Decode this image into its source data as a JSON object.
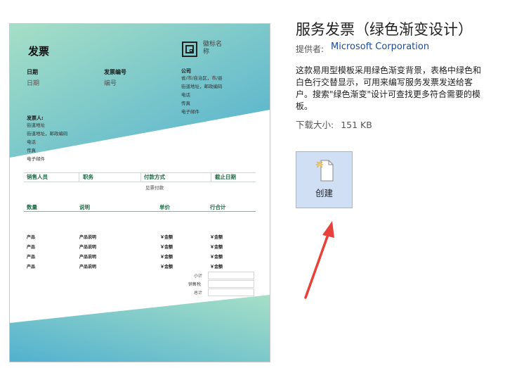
{
  "template": {
    "title": "服务发票（绿色渐变设计）",
    "provider_label": "提供者:",
    "provider": "Microsoft Corporation",
    "description": "这款易用型模板采用绿色渐变背景，表格中绿色和白色行交替显示，可用来编写服务发票发送给客户。搜索\"绿色渐变\"设计可查找更多符合需要的模板。",
    "size_label": "下载大小:",
    "size": "151 KB",
    "create_label": "创建"
  },
  "preview": {
    "heading": "发票",
    "logo_text": "徽标名称",
    "date_label": "日期",
    "date_value": "日期",
    "invoice_no_label": "发票编号",
    "invoice_no_value": "编号",
    "company_label": "公司",
    "company_lines": [
      "省/市/自治区，市/县",
      "街道地址，邮政编码",
      "电话",
      "传真",
      "电子邮件"
    ],
    "bill_to_label": "发票人:",
    "bill_to_lines": [
      "街道地址",
      "街道地址，邮政编码",
      "电话",
      "传真",
      "电子邮件"
    ],
    "sales_headers": [
      "销售人员",
      "职务",
      "付款方式",
      "截止日期"
    ],
    "payment_terms": "见票付款",
    "item_headers": [
      "数量",
      "说明",
      "单价",
      "行合计"
    ],
    "items": [
      {
        "product": "产品",
        "desc": "产品说明",
        "price": "￥金额",
        "total": "￥金额"
      },
      {
        "product": "产品",
        "desc": "产品说明",
        "price": "￥金额",
        "total": "￥金额"
      },
      {
        "product": "产品",
        "desc": "产品说明",
        "price": "￥金额",
        "total": "￥金额"
      },
      {
        "product": "产品",
        "desc": "产品说明",
        "price": "￥金额",
        "total": "￥金额"
      }
    ],
    "totals": [
      "小计",
      "销售税",
      "总计"
    ]
  },
  "colors": {
    "gradient_start": "#a6dfc6",
    "gradient_end": "#52b1cf",
    "header_text": "#1f6b45",
    "create_bg": "#d0dff4",
    "arrow": "#e8403a",
    "link": "#1a4a9a"
  },
  "icons": {
    "create_button": "new-document-icon",
    "annotation": "red-arrow-icon"
  }
}
